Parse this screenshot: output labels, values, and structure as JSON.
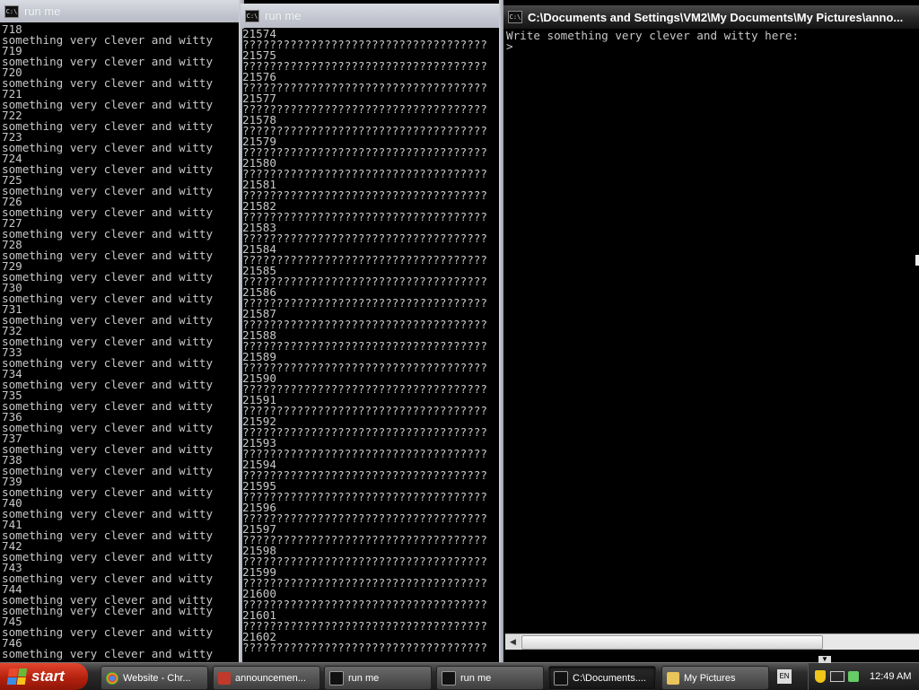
{
  "windows": {
    "left": {
      "title": "run me",
      "lines": [
        "718",
        "something very clever and witty",
        "719",
        "something very clever and witty",
        "720",
        "something very clever and witty",
        "721",
        "something very clever and witty",
        "722",
        "something very clever and witty",
        "723",
        "something very clever and witty",
        "724",
        "something very clever and witty",
        "725",
        "something very clever and witty",
        "726",
        "something very clever and witty",
        "727",
        "something very clever and witty",
        "728",
        "something very clever and witty",
        "729",
        "something very clever and witty",
        "730",
        "something very clever and witty",
        "731",
        "something very clever and witty",
        "732",
        "something very clever and witty",
        "733",
        "something very clever and witty",
        "734",
        "something very clever and witty",
        "735",
        "something very clever and witty",
        "736",
        "something very clever and witty",
        "737",
        "something very clever and witty",
        "738",
        "something very clever and witty",
        "739",
        "something very clever and witty",
        "740",
        "something very clever and witty",
        "741",
        "something very clever and witty",
        "742",
        "something very clever and witty",
        "743",
        "something very clever and witty",
        "744",
        "something very clever and witty",
        "something very clever and witty",
        "745",
        "something very clever and witty",
        "746",
        "something very clever and witty"
      ]
    },
    "middle": {
      "title": "run me",
      "lines": [
        "21574",
        "????????????????????????????????????",
        "21575",
        "????????????????????????????????????",
        "21576",
        "????????????????????????????????????",
        "21577",
        "????????????????????????????????????",
        "21578",
        "????????????????????????????????????",
        "21579",
        "????????????????????????????????????",
        "21580",
        "????????????????????????????????????",
        "21581",
        "????????????????????????????????????",
        "21582",
        "????????????????????????????????????",
        "21583",
        "????????????????????????????????????",
        "21584",
        "????????????????????????????????????",
        "21585",
        "????????????????????????????????????",
        "21586",
        "????????????????????????????????????",
        "21587",
        "????????????????????????????????????",
        "21588",
        "????????????????????????????????????",
        "21589",
        "????????????????????????????????????",
        "21590",
        "????????????????????????????????????",
        "21591",
        "????????????????????????????????????",
        "21592",
        "????????????????????????????????????",
        "21593",
        "????????????????????????????????????",
        "21594",
        "????????????????????????????????????",
        "21595",
        "????????????????????????????????????",
        "21596",
        "????????????????????????????????????",
        "21597",
        "????????????????????????????????????",
        "21598",
        "????????????????????????????????????",
        "21599",
        "????????????????????????????????????",
        "21600",
        "????????????????????????????????????",
        "21601",
        "????????????????????????????????????",
        "21602",
        "????????????????????????????????????"
      ]
    },
    "right": {
      "title": "C:\\Documents and Settings\\VM2\\My Documents\\My Pictures\\anno...",
      "lines": [
        "Write something very clever and witty here:",
        ">"
      ]
    }
  },
  "taskbar": {
    "start_label": "start",
    "tasks": [
      {
        "label": "Website - Chr...",
        "icon": "chrome-icon",
        "color": "#3b78c6"
      },
      {
        "label": "announcemen...",
        "icon": "pdf-icon",
        "color": "#c0392b"
      },
      {
        "label": "run me",
        "icon": "console-icon",
        "color": "#111111"
      },
      {
        "label": "run me",
        "icon": "console-icon",
        "color": "#111111"
      },
      {
        "label": "C:\\Documents....",
        "icon": "console-icon",
        "color": "#111111"
      },
      {
        "label": "My Pictures",
        "icon": "folder-icon",
        "color": "#e8c45a"
      }
    ],
    "lang": "EN",
    "clock": "12:49 AM"
  },
  "colors": {
    "console_text": "#c8c8c8",
    "start_button": "#c0281a",
    "flag": [
      "#e8482c",
      "#6bb83a",
      "#3b8ee6",
      "#f5c31c"
    ]
  }
}
